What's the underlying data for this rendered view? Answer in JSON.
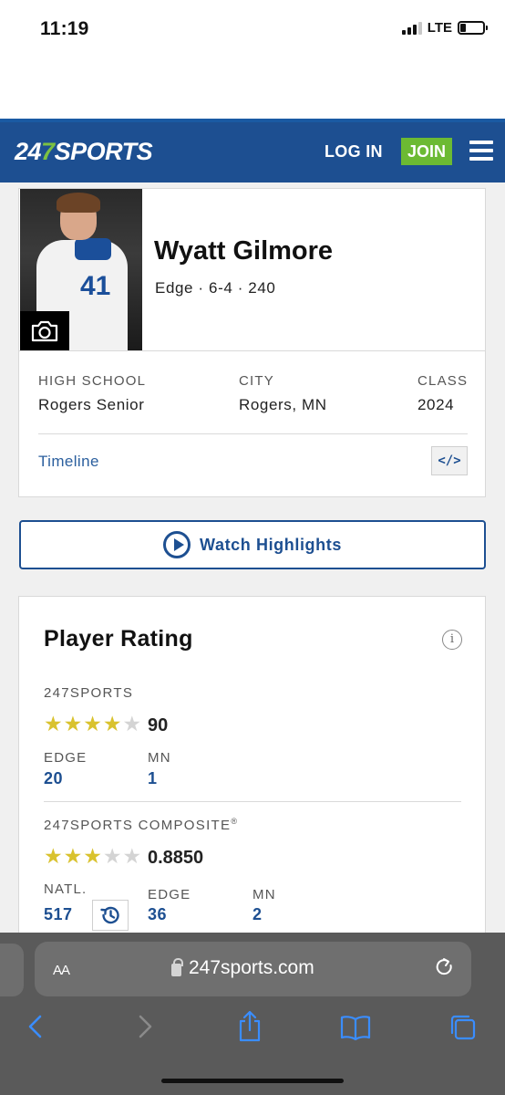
{
  "status_bar": {
    "time": "11:19",
    "network": "LTE"
  },
  "header": {
    "logo_prefix": "24",
    "logo_seven": "7",
    "logo_suffix": "SPORTS",
    "login_label": "LOG IN",
    "join_label": "JOIN",
    "colors": {
      "header_bg": "#1d4f91",
      "join_bg": "#6cba33"
    }
  },
  "player": {
    "name": "Wyatt Gilmore",
    "meta": "Edge · 6-4 · 240",
    "jersey_number": "41",
    "high_school_label": "HIGH SCHOOL",
    "high_school": "Rogers Senior",
    "city_label": "CITY",
    "city": "Rogers, MN",
    "class_label": "CLASS",
    "class_year": "2024",
    "timeline_label": "Timeline",
    "embed_label": "</>"
  },
  "watch_button": {
    "label": "Watch Highlights"
  },
  "rating": {
    "title": "Player Rating",
    "info_label": "i",
    "s247": {
      "label": "247SPORTS",
      "stars_filled": 4,
      "stars_total": 5,
      "score": "90",
      "ranks": [
        {
          "label": "EDGE",
          "value": "20"
        },
        {
          "label": "MN",
          "value": "1"
        }
      ]
    },
    "composite": {
      "label": "247SPORTS COMPOSITE",
      "reg_mark": "®",
      "stars_filled": 3,
      "stars_total": 5,
      "score": "0.8850",
      "ranks": [
        {
          "label": "NATL.",
          "value": "517"
        },
        {
          "label": "EDGE",
          "value": "36"
        },
        {
          "label": "MN",
          "value": "2"
        }
      ]
    },
    "star_color": "#d9c22e"
  },
  "browser": {
    "aa_label": "AA",
    "url": "247sports.com"
  }
}
